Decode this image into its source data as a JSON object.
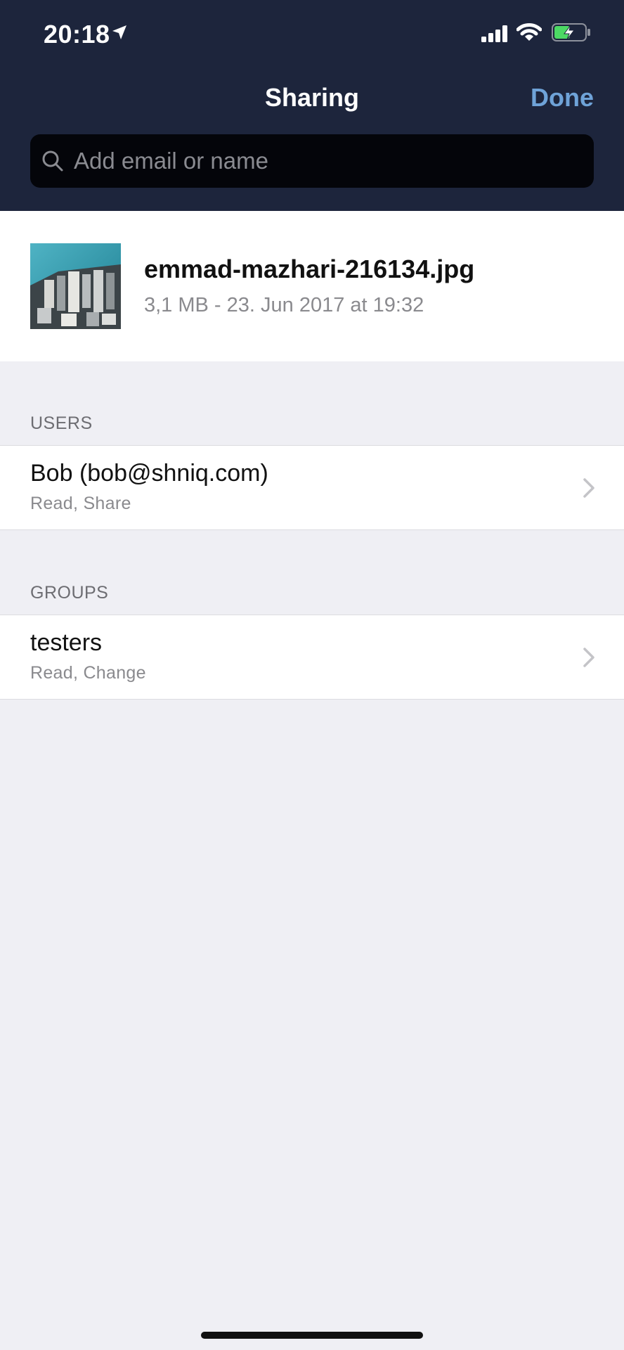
{
  "status_bar": {
    "time": "20:18",
    "icons": [
      "location-arrow-icon",
      "signal-bars-icon",
      "wifi-icon",
      "battery-charging-icon"
    ]
  },
  "nav": {
    "title": "Sharing",
    "done_label": "Done"
  },
  "search": {
    "placeholder": "Add email or name",
    "value": ""
  },
  "file": {
    "name": "emmad-mazhari-216134.jpg",
    "meta": "3,1 MB - 23. Jun 2017 at 19:32"
  },
  "users": {
    "header": "USERS",
    "items": [
      {
        "title": "Bob (bob@shniq.com)",
        "subtitle": "Read, Share"
      }
    ]
  },
  "groups": {
    "header": "GROUPS",
    "items": [
      {
        "title": "testers",
        "subtitle": "Read, Change"
      }
    ]
  },
  "colors": {
    "header_bg": "#1d253c",
    "accent": "#6fa3d8",
    "page_bg": "#efeff4",
    "battery_green": "#4cd964"
  }
}
